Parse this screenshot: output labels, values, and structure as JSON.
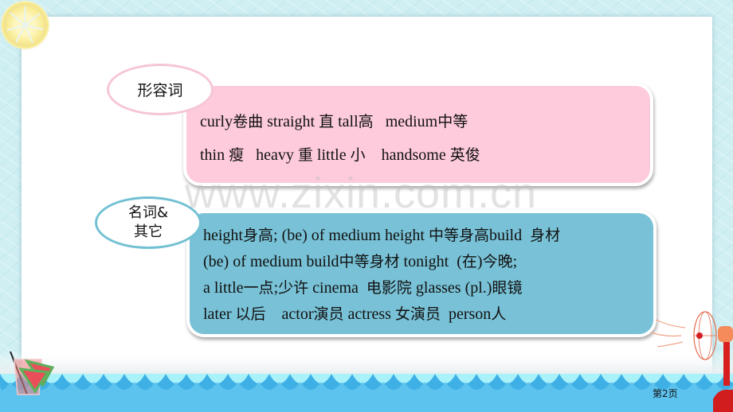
{
  "slide": {
    "watermark": "www.zixin.com.cn",
    "page_number": "第2页"
  },
  "sections": [
    {
      "label": "形容词",
      "color": "#fecbdc",
      "border_color": "#f6c6d6",
      "lines": [
        [
          {
            "t": "curly"
          },
          {
            "t": "卷曲",
            "zh": true
          },
          {
            "t": " straight "
          },
          {
            "t": "直",
            "zh": true
          },
          {
            "t": " tall"
          },
          {
            "t": "高",
            "zh": true
          },
          {
            "t": "   medium"
          },
          {
            "t": "中等",
            "zh": true
          }
        ],
        [
          {
            "t": "thin "
          },
          {
            "t": "瘦",
            "zh": true
          },
          {
            "t": "   heavy "
          },
          {
            "t": "重",
            "zh": true
          },
          {
            "t": " little "
          },
          {
            "t": "小",
            "zh": true
          },
          {
            "t": "    handsome "
          },
          {
            "t": "英俊",
            "zh": true
          }
        ]
      ]
    },
    {
      "label_line1": "名词&",
      "label_line2": "其它",
      "color": "#78c1d6",
      "border_color": "#72c0d3",
      "lines": [
        [
          {
            "t": "height"
          },
          {
            "t": "身高",
            "zh": true
          },
          {
            "t": "; (be) of medium height "
          },
          {
            "t": "中等身高",
            "zh": true
          },
          {
            "t": "build  "
          },
          {
            "t": "身材",
            "zh": true
          }
        ],
        [
          {
            "t": "(be) of medium build"
          },
          {
            "t": "中等身材",
            "zh": true
          },
          {
            "t": " tonight  ("
          },
          {
            "t": "在",
            "zh": true
          },
          {
            "t": ")"
          },
          {
            "t": "今晚",
            "zh": true
          },
          {
            "t": ";"
          }
        ],
        [
          {
            "t": "a little"
          },
          {
            "t": "一点",
            "zh": true
          },
          {
            "t": ";"
          },
          {
            "t": "少许",
            "zh": true
          },
          {
            "t": " cinema  "
          },
          {
            "t": "电影院",
            "zh": true
          },
          {
            "t": " glasses (pl.)"
          },
          {
            "t": "眼镜",
            "zh": true
          }
        ],
        [
          {
            "t": "later "
          },
          {
            "t": "以后",
            "zh": true
          },
          {
            "t": "    actor"
          },
          {
            "t": "演员",
            "zh": true
          },
          {
            "t": " actress "
          },
          {
            "t": "女演员",
            "zh": true
          },
          {
            "t": "  person"
          },
          {
            "t": "人",
            "zh": true
          }
        ]
      ]
    }
  ],
  "decorations": {
    "top_left": "lemon-slice-icon",
    "bottom_left": "watermelon-and-juice-icon",
    "bottom_right": "electric-fan-icon",
    "bottom_band": "wave-border"
  }
}
